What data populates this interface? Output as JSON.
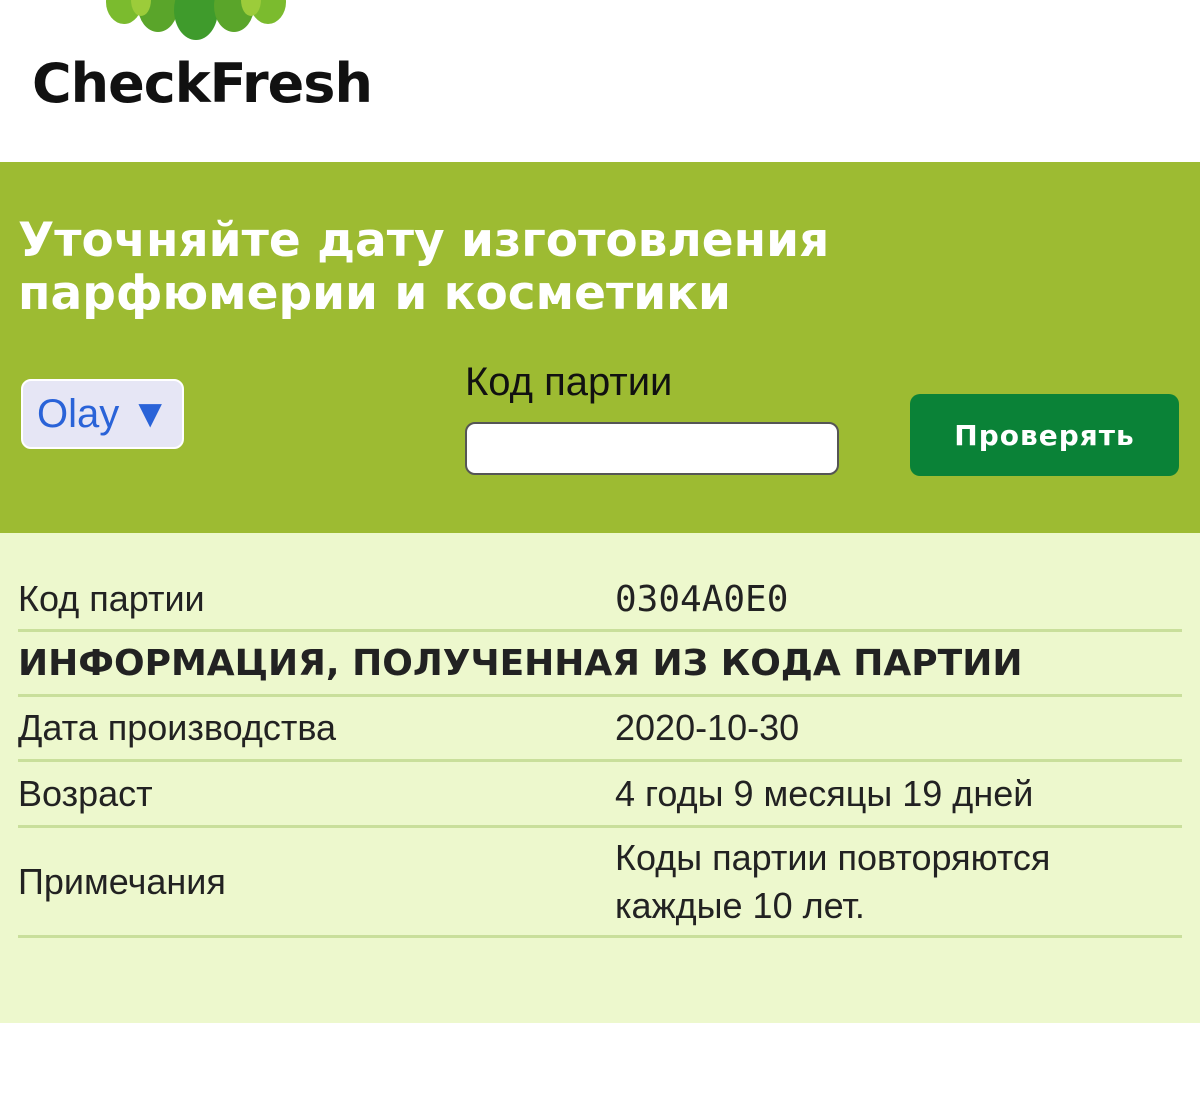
{
  "header": {
    "brand": "CheckFresh",
    "logo_icon": "green-leaves-logo-icon"
  },
  "hero": {
    "title": "Уточняйте дату изготовления парфюмерии и косметики",
    "brand_select": {
      "selected": "Olay",
      "arrow": "▼"
    },
    "batch_label": "Код партии",
    "batch_input": {
      "value": "",
      "placeholder": ""
    },
    "check_button": "Проверять"
  },
  "results": {
    "batch_code": {
      "label": "Код партии",
      "value": "0304A0E0"
    },
    "section_title": "ИНФОРМАЦИЯ, ПОЛУЧЕННАЯ ИЗ КОДА ПАРТИИ",
    "production_date": {
      "label": "Дата производства",
      "value": "2020-10-30"
    },
    "age": {
      "label": "Возраст",
      "value": "4 годы 9 месяцы 19 дней"
    },
    "notes": {
      "label": "Примечания",
      "value": "Коды партии повторяются каждые 10 лет."
    }
  },
  "colors": {
    "hero_background": "#9dbb32",
    "results_background": "#edf8cd",
    "button_background": "#0a8237",
    "select_text": "#2a63d8",
    "row_divider": "#c9df9b"
  }
}
